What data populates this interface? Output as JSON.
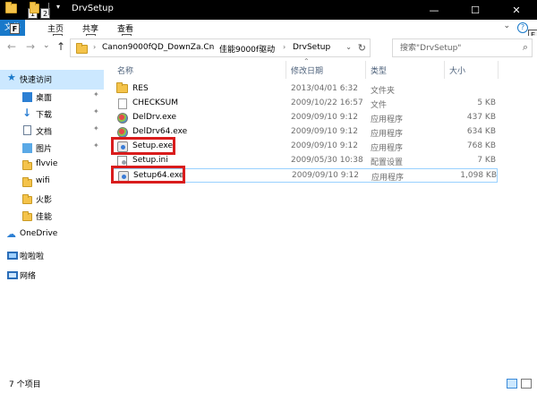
{
  "window": {
    "title": "DrvSetup",
    "minimize_glyph": "—",
    "maximize_glyph": "☐",
    "close_glyph": "✕"
  },
  "quick_access_toolbar": {
    "keytips": [
      "1",
      "2"
    ],
    "dropdown_glyph": "▾"
  },
  "ribbon": {
    "file_tab": "文件",
    "file_keytip": "F",
    "tabs": [
      {
        "label": "主页",
        "keytip": "H"
      },
      {
        "label": "共享",
        "keytip": "S"
      },
      {
        "label": "查看",
        "keytip": "V"
      }
    ],
    "help_glyph": "?",
    "help_keytip": "E",
    "expand_glyph": "⌄"
  },
  "navigation": {
    "back_glyph": "←",
    "forward_glyph": "→",
    "recent_glyph": "⌄",
    "up_glyph": "↑",
    "breadcrumb_sep": "›",
    "breadcrumbs": [
      "Canon9000fQD_DownZa.Cn",
      "佳能9000f驱动",
      "DrvSetup"
    ],
    "address_dropdown_glyph": "⌄",
    "refresh_glyph": "↻",
    "search_placeholder": "搜索\"DrvSetup\"",
    "search_glyph": "⌕"
  },
  "nav_pane": {
    "pin_glyph": "✦",
    "star_glyph": "★",
    "arrow_glyph": "↓",
    "cloud_glyph": "☁",
    "quick_access": "快速访问",
    "items": [
      {
        "label": "桌面",
        "pinned": true
      },
      {
        "label": "下载",
        "pinned": true
      },
      {
        "label": "文档",
        "pinned": true
      },
      {
        "label": "图片",
        "pinned": true
      },
      {
        "label": "flvvie",
        "pinned": false
      },
      {
        "label": "wifi",
        "pinned": false
      },
      {
        "label": "火影",
        "pinned": false
      },
      {
        "label": "佳能",
        "pinned": false
      }
    ],
    "onedrive": "OneDrive",
    "this_pc": "啦啦啦",
    "network": "网络"
  },
  "file_list": {
    "sort_glyph": "⌃",
    "columns": {
      "name": "名称",
      "date": "修改日期",
      "type": "类型",
      "size": "大小"
    },
    "rows": [
      {
        "name": "RES",
        "date": "2013/04/01 6:32",
        "type": "文件夹",
        "size": "",
        "icon": "folder-icon",
        "highlighted": false
      },
      {
        "name": "CHECKSUM",
        "date": "2009/10/22 16:57",
        "type": "文件",
        "size": "5 KB",
        "icon": "file-icon",
        "highlighted": false
      },
      {
        "name": "DelDrv.exe",
        "date": "2009/09/10 9:12",
        "type": "应用程序",
        "size": "437 KB",
        "icon": "exe-icon",
        "highlighted": false
      },
      {
        "name": "DelDrv64.exe",
        "date": "2009/09/10 9:12",
        "type": "应用程序",
        "size": "634 KB",
        "icon": "exe-icon",
        "highlighted": false
      },
      {
        "name": "Setup.exe",
        "date": "2009/09/10 9:12",
        "type": "应用程序",
        "size": "768 KB",
        "icon": "setup-icon",
        "highlighted": true
      },
      {
        "name": "Setup.ini",
        "date": "2009/05/30 10:38",
        "type": "配置设置",
        "size": "7 KB",
        "icon": "ini-icon",
        "highlighted": false
      },
      {
        "name": "Setup64.exe",
        "date": "2009/09/10 9:12",
        "type": "应用程序",
        "size": "1,098 KB",
        "icon": "setup-icon",
        "highlighted": true
      }
    ]
  },
  "status": {
    "item_count": "7 个项目"
  },
  "colors": {
    "highlight_box": "#d91c1c",
    "accent": "#1979ca",
    "selection": "#cce8ff"
  }
}
